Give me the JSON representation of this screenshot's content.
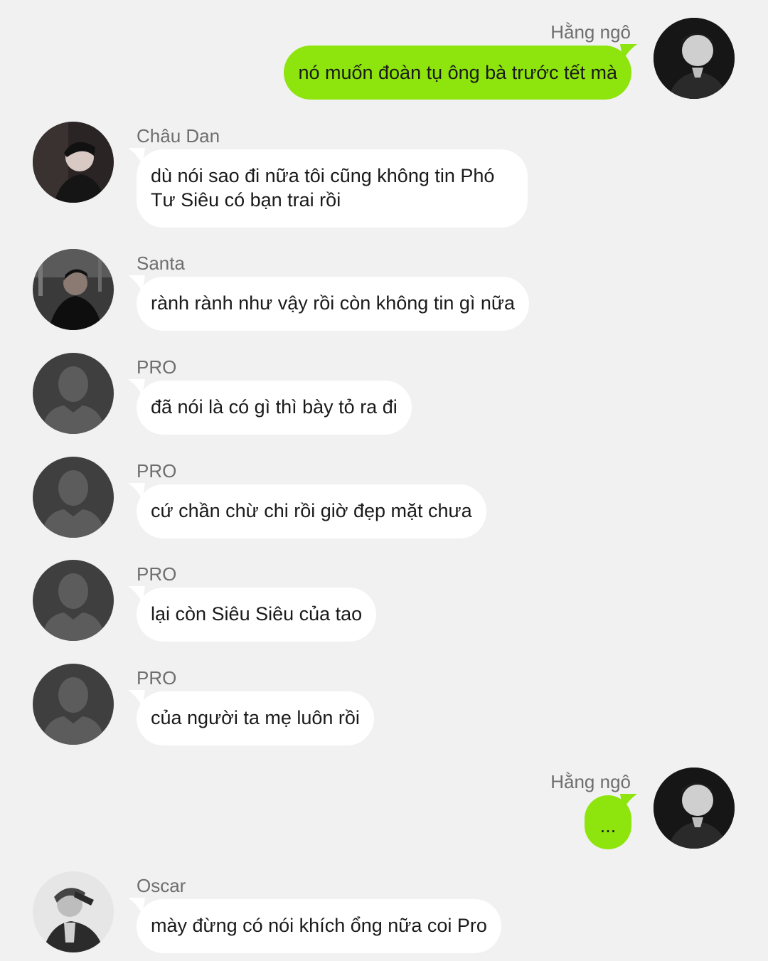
{
  "colors": {
    "background": "#f1f1f1",
    "outgoing_bubble": "#8ee40d",
    "incoming_bubble": "#ffffff",
    "name_text": "#6e6e6e",
    "message_text": "#1a1a1a"
  },
  "messages": [
    {
      "direction": "outgoing",
      "sender": "Hằng ngô",
      "text": "nó muốn đoàn tụ ông bà trước tết mà",
      "avatar": "photo-avatar"
    },
    {
      "direction": "incoming",
      "sender": "Châu Dan",
      "text": "dù nói sao đi nữa tôi cũng không tin Phó\nTư Siêu có bạn trai rồi",
      "avatar": "photo-avatar"
    },
    {
      "direction": "incoming",
      "sender": "Santa",
      "text": "rành rành như vậy rồi còn không tin gì nữa",
      "avatar": "photo-avatar"
    },
    {
      "direction": "incoming",
      "sender": "PRO",
      "text": "đã nói là có gì thì bày tỏ ra đi",
      "avatar": "default-user-icon"
    },
    {
      "direction": "incoming",
      "sender": "PRO",
      "text": "cứ chần chừ chi rồi giờ đẹp mặt chưa",
      "avatar": "default-user-icon"
    },
    {
      "direction": "incoming",
      "sender": "PRO",
      "text": "lại còn Siêu Siêu của tao",
      "avatar": "default-user-icon"
    },
    {
      "direction": "incoming",
      "sender": "PRO",
      "text": "của người ta mẹ luôn rồi",
      "avatar": "default-user-icon"
    },
    {
      "direction": "outgoing",
      "sender": "Hằng ngô",
      "text": "...",
      "avatar": "photo-avatar"
    },
    {
      "direction": "incoming",
      "sender": "Oscar",
      "text": "mày đừng có nói khích ổng nữa coi Pro",
      "avatar": "photo-avatar"
    }
  ]
}
